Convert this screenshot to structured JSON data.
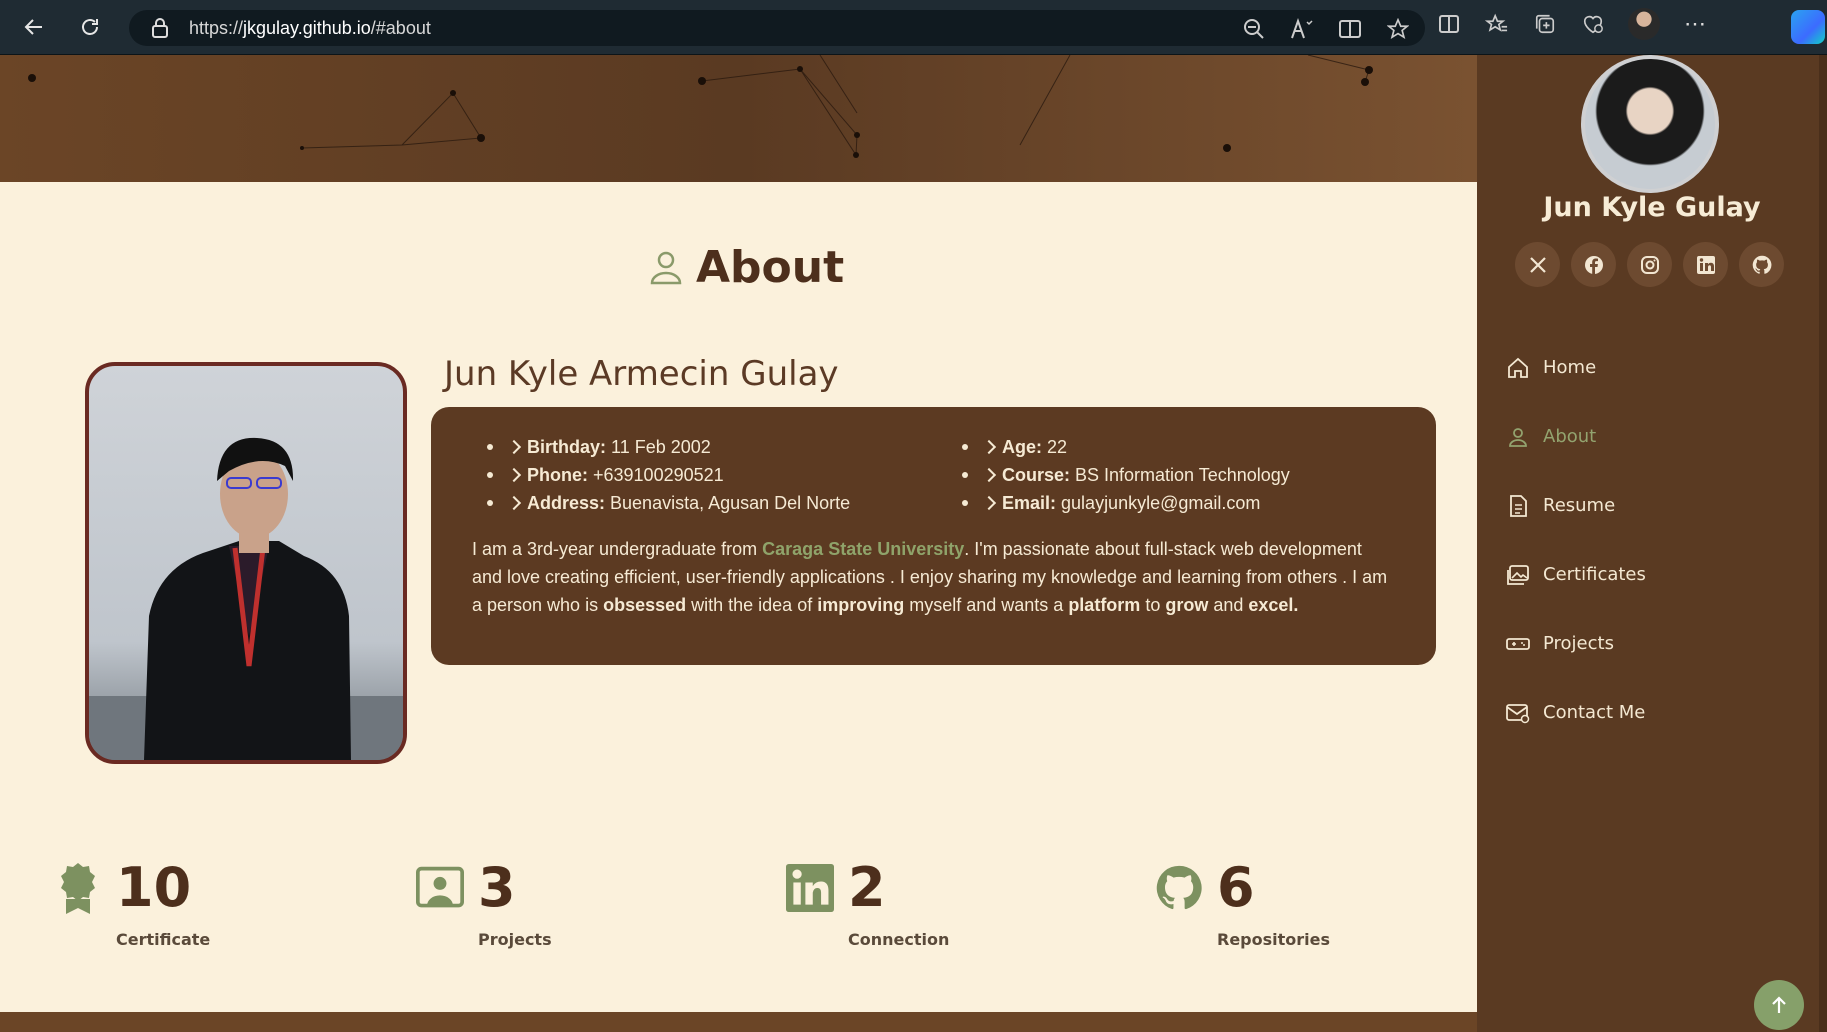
{
  "browser": {
    "url_prefix": "https://",
    "url_domain": "jkgulay.github.io",
    "url_path": "/#about"
  },
  "about": {
    "heading": "About",
    "full_name": "Jun Kyle Armecin Gulay",
    "info_left": [
      {
        "label": "Birthday:",
        "value": "11 Feb 2002"
      },
      {
        "label": "Phone:",
        "value": "+639100290521"
      },
      {
        "label": "Address:",
        "value": "Buenavista, Agusan Del Norte"
      }
    ],
    "info_right": [
      {
        "label": "Age:",
        "value": "22"
      },
      {
        "label": "Course:",
        "value": "BS Information Technology"
      },
      {
        "label": "Email:",
        "value": "gulayjunkyle@gmail.com"
      }
    ],
    "bio": {
      "p1": "I am a 3rd-year undergraduate from ",
      "university": "Caraga State University",
      "p2": ". I'm passionate about full-stack web development and love creating efficient, user-friendly applications . I enjoy sharing my knowledge and learning from others . I am a person who is ",
      "w1": "obsessed",
      "p3": " with the idea of ",
      "w2": "improving",
      "p4": " myself and wants a ",
      "w3": "platform",
      "p5": " to ",
      "w4": "grow",
      "p6": " and ",
      "w5": "excel."
    }
  },
  "stats": [
    {
      "number": "10",
      "label": "Certificate",
      "icon": "award-icon"
    },
    {
      "number": "3",
      "label": "Projects",
      "icon": "portrait-icon"
    },
    {
      "number": "2",
      "label": "Connection",
      "icon": "linkedin-icon"
    },
    {
      "number": "6",
      "label": "Repositories",
      "icon": "github-icon"
    }
  ],
  "sidebar": {
    "name": "Jun Kyle Gulay",
    "socials": [
      "x-icon",
      "facebook-icon",
      "instagram-icon",
      "linkedin-icon",
      "github-icon"
    ],
    "nav": [
      {
        "label": "Home",
        "icon": "home-icon",
        "active": false
      },
      {
        "label": "About",
        "icon": "person-icon",
        "active": true
      },
      {
        "label": "Resume",
        "icon": "file-icon",
        "active": false
      },
      {
        "label": "Certificates",
        "icon": "images-icon",
        "active": false
      },
      {
        "label": "Projects",
        "icon": "projects-icon",
        "active": false
      },
      {
        "label": "Contact Me",
        "icon": "envelope-icon",
        "active": false
      }
    ]
  },
  "colors": {
    "brown_dark": "#5a3a22",
    "cream": "#fbf1dc",
    "accent_green": "#86a06a"
  }
}
